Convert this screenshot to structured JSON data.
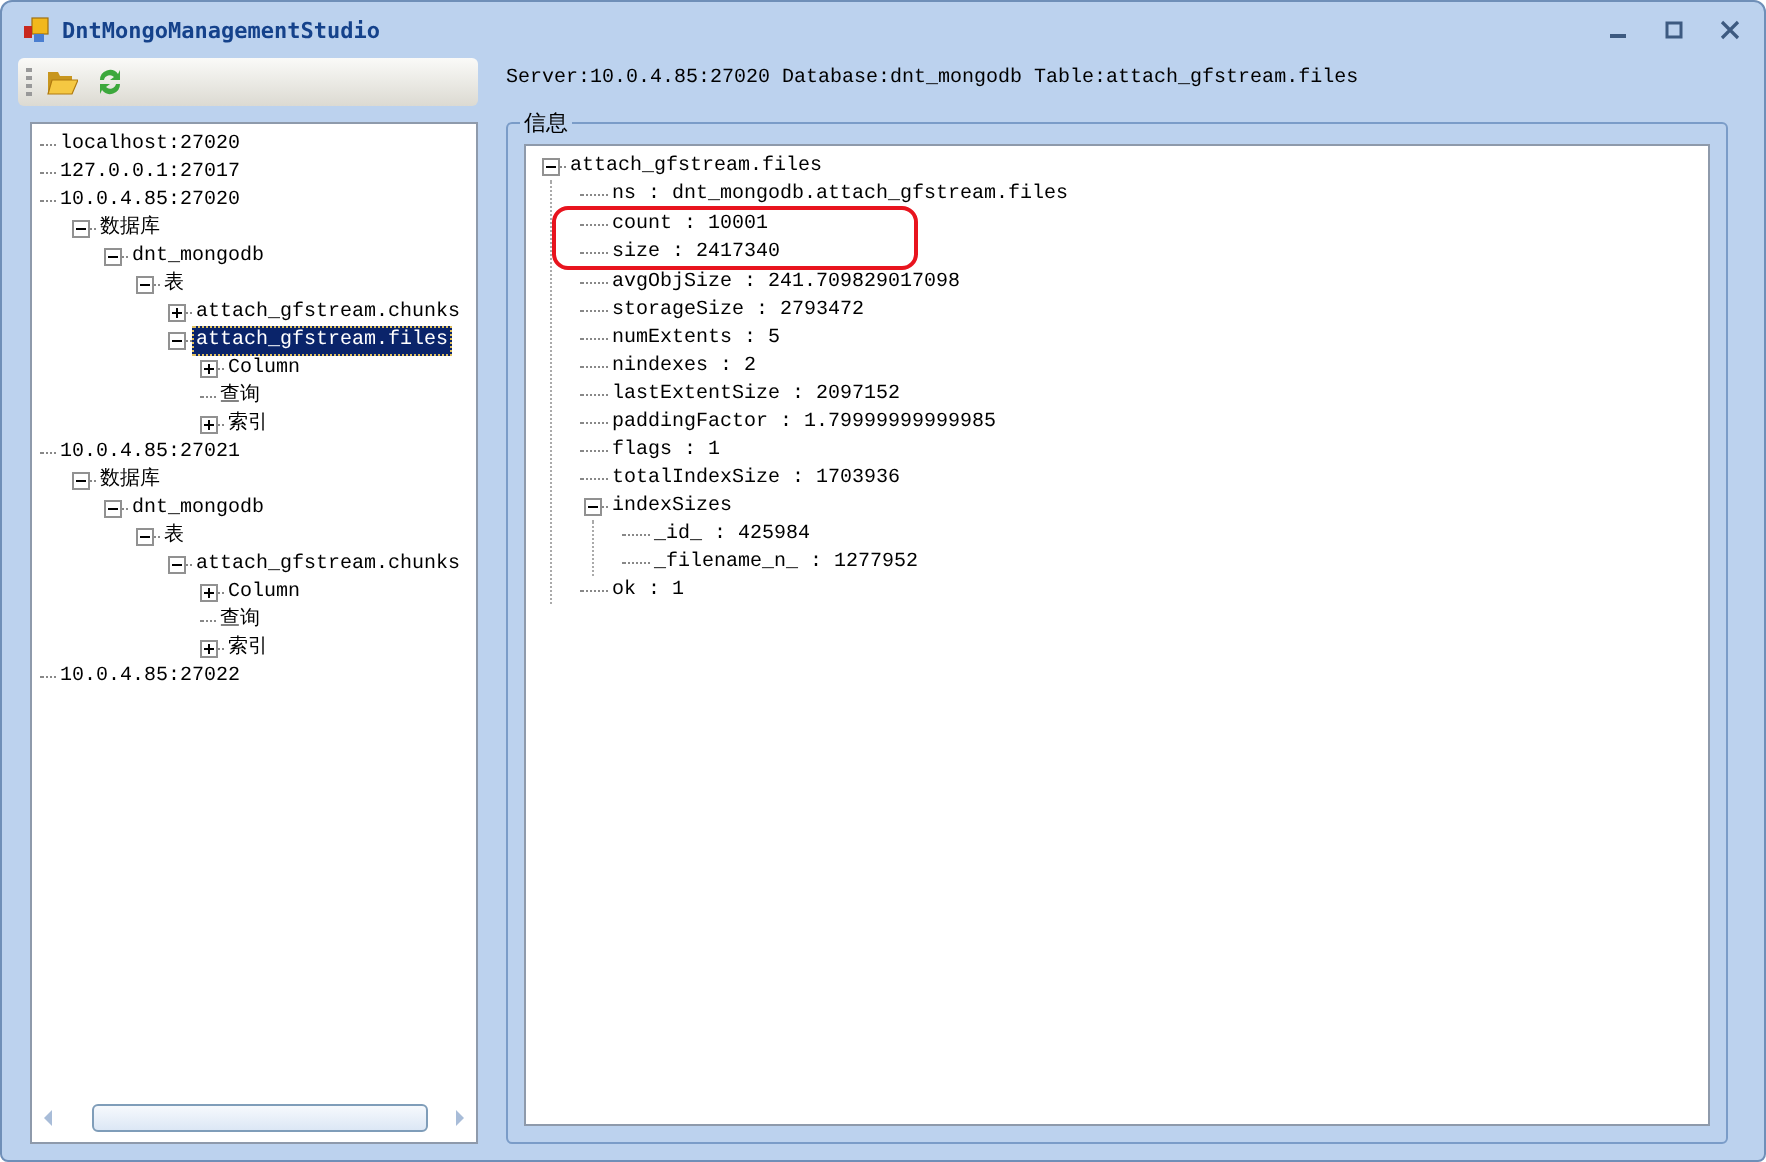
{
  "window": {
    "title": "DntMongoManagementStudio"
  },
  "toolbar": {
    "buttons": [
      {
        "kind": "open"
      },
      {
        "kind": "refresh"
      }
    ]
  },
  "connection_tree": [
    {
      "label": "localhost:27020",
      "selected": false
    },
    {
      "label": "127.0.0.1:27017",
      "selected": false
    },
    {
      "label": "10.0.4.85:27020",
      "selected": false,
      "children": [
        {
          "label": "数据库",
          "selected": false,
          "expanded": true,
          "children": [
            {
              "label": "dnt_mongodb",
              "selected": false,
              "expanded": true,
              "children": [
                {
                  "label": "表",
                  "selected": false,
                  "expanded": true,
                  "children": [
                    {
                      "label": "attach_gfstream.chunks",
                      "selected": false,
                      "expanded": false
                    },
                    {
                      "label": "attach_gfstream.files",
                      "selected": true,
                      "expanded": true,
                      "children": [
                        {
                          "label": "Column",
                          "selected": false,
                          "expanded": false
                        },
                        {
                          "label": "查询",
                          "selected": false
                        },
                        {
                          "label": "索引",
                          "selected": false,
                          "expanded": false
                        }
                      ]
                    }
                  ]
                }
              ]
            }
          ]
        }
      ]
    },
    {
      "label": "10.0.4.85:27021",
      "selected": false,
      "children": [
        {
          "label": "数据库",
          "selected": false,
          "expanded": true,
          "children": [
            {
              "label": "dnt_mongodb",
              "selected": false,
              "expanded": true,
              "children": [
                {
                  "label": "表",
                  "selected": false,
                  "expanded": true,
                  "children": [
                    {
                      "label": "attach_gfstream.chunks",
                      "selected": false,
                      "expanded": true,
                      "children": [
                        {
                          "label": "Column",
                          "selected": false,
                          "expanded": false
                        },
                        {
                          "label": "查询",
                          "selected": false
                        },
                        {
                          "label": "索引",
                          "selected": false,
                          "expanded": false
                        }
                      ]
                    }
                  ]
                }
              ]
            }
          ]
        }
      ]
    },
    {
      "label": "10.0.4.85:27022",
      "selected": false
    }
  ],
  "status_label": "Server:10.0.4.85:27020 Database:dnt_mongodb Table:attach_gfstream.files",
  "info_group": {
    "title": "信息",
    "tree": [
      {
        "label": "attach_gfstream.files",
        "expanded": true,
        "children": [
          {
            "label": "ns : dnt_mongodb.attach_gfstream.files",
            "highlighted": false
          },
          {
            "label": "count : 10001",
            "highlighted": true
          },
          {
            "label": "size : 2417340",
            "highlighted": true
          },
          {
            "label": "avgObjSize : 241.709829017098",
            "highlighted": false
          },
          {
            "label": "storageSize : 2793472",
            "highlighted": false
          },
          {
            "label": "numExtents : 5",
            "highlighted": false
          },
          {
            "label": "nindexes : 2",
            "highlighted": false
          },
          {
            "label": "lastExtentSize : 2097152",
            "highlighted": false
          },
          {
            "label": "paddingFactor : 1.79999999999985",
            "highlighted": false
          },
          {
            "label": "flags : 1",
            "highlighted": false
          },
          {
            "label": "totalIndexSize : 1703936",
            "highlighted": false
          },
          {
            "label": "indexSizes",
            "highlighted": false,
            "expanded": true,
            "children": [
              {
                "label": "_id_ : 425984",
                "highlighted": false
              },
              {
                "label": "_filename_n_ : 1277952",
                "highlighted": false
              }
            ]
          },
          {
            "label": "ok : 1",
            "highlighted": false
          }
        ]
      }
    ]
  }
}
